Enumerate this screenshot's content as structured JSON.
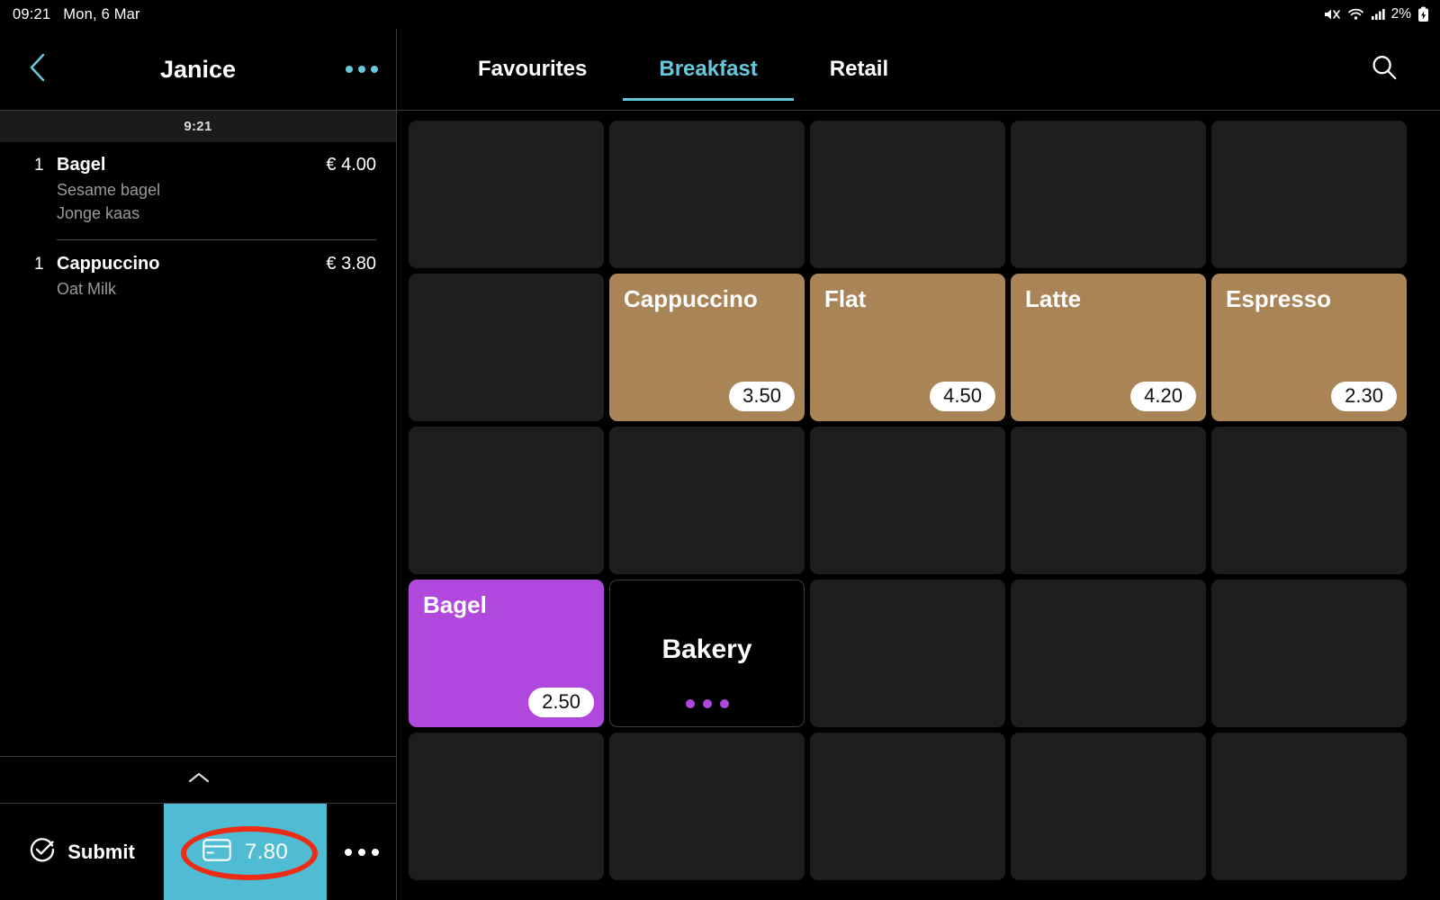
{
  "statusbar": {
    "time": "09:21",
    "date": "Mon, 6 Mar",
    "battery_percent": "2%",
    "icons": [
      "mute-icon",
      "wifi-icon",
      "signal-icon",
      "battery-charging-icon"
    ]
  },
  "order": {
    "title": "Janice",
    "back_icon": "chevron-left-icon",
    "more_icon": "more-horizontal-icon",
    "time_band": "9:21",
    "lines": [
      {
        "qty": "1",
        "name": "Bagel",
        "price": "€ 4.00",
        "modifiers": [
          "Sesame bagel",
          "Jonge kaas"
        ]
      },
      {
        "qty": "1",
        "name": "Cappuccino",
        "price": "€ 3.80",
        "modifiers": [
          "Oat Milk"
        ]
      }
    ],
    "collapse_icon": "chevron-up-icon",
    "submit_label": "Submit",
    "submit_icon": "check-circle-icon",
    "pay_icon": "credit-card-icon",
    "pay_amount": "7.80",
    "more_actions_icon": "more-horizontal-icon"
  },
  "catalog": {
    "tabs": [
      {
        "label": "Favourites",
        "active": false
      },
      {
        "label": "Breakfast",
        "active": true
      },
      {
        "label": "Retail",
        "active": false
      }
    ],
    "search_icon": "search-icon",
    "columns": 5,
    "rows": 5,
    "tiles": [
      {
        "row": 1,
        "col": 1,
        "type": "empty"
      },
      {
        "row": 1,
        "col": 2,
        "type": "empty"
      },
      {
        "row": 1,
        "col": 3,
        "type": "empty"
      },
      {
        "row": 1,
        "col": 4,
        "type": "empty"
      },
      {
        "row": 1,
        "col": 5,
        "type": "empty"
      },
      {
        "row": 2,
        "col": 1,
        "type": "empty"
      },
      {
        "row": 2,
        "col": 2,
        "type": "product",
        "name": "Cappuccino",
        "price": "3.50",
        "color": "#a98456"
      },
      {
        "row": 2,
        "col": 3,
        "type": "product",
        "name": "Flat",
        "price": "4.50",
        "color": "#a98456"
      },
      {
        "row": 2,
        "col": 4,
        "type": "product",
        "name": "Latte",
        "price": "4.20",
        "color": "#a98456"
      },
      {
        "row": 2,
        "col": 5,
        "type": "product",
        "name": "Espresso",
        "price": "2.30",
        "color": "#a98456"
      },
      {
        "row": 3,
        "col": 1,
        "type": "empty"
      },
      {
        "row": 3,
        "col": 2,
        "type": "empty"
      },
      {
        "row": 3,
        "col": 3,
        "type": "empty"
      },
      {
        "row": 3,
        "col": 4,
        "type": "empty"
      },
      {
        "row": 3,
        "col": 5,
        "type": "empty"
      },
      {
        "row": 4,
        "col": 1,
        "type": "product",
        "name": "Bagel",
        "price": "2.50",
        "color": "#b048dd"
      },
      {
        "row": 4,
        "col": 2,
        "type": "category",
        "name": "Bakery",
        "dot_color": "#b048dd",
        "dots": 3
      },
      {
        "row": 4,
        "col": 3,
        "type": "empty"
      },
      {
        "row": 4,
        "col": 4,
        "type": "empty"
      },
      {
        "row": 4,
        "col": 5,
        "type": "empty"
      },
      {
        "row": 5,
        "col": 1,
        "type": "empty"
      },
      {
        "row": 5,
        "col": 2,
        "type": "empty"
      },
      {
        "row": 5,
        "col": 3,
        "type": "empty"
      },
      {
        "row": 5,
        "col": 4,
        "type": "empty"
      },
      {
        "row": 5,
        "col": 5,
        "type": "empty"
      }
    ]
  },
  "annotation": {
    "shape": "ellipse",
    "color": "#ee2b14",
    "target": "pay-button"
  },
  "colors": {
    "accent": "#67c8dc",
    "pay_button": "#4fbcd3",
    "coffee_tile": "#a98456",
    "bakery_tile": "#b048dd",
    "empty_tile": "#1e1e1e",
    "background": "#000000"
  }
}
